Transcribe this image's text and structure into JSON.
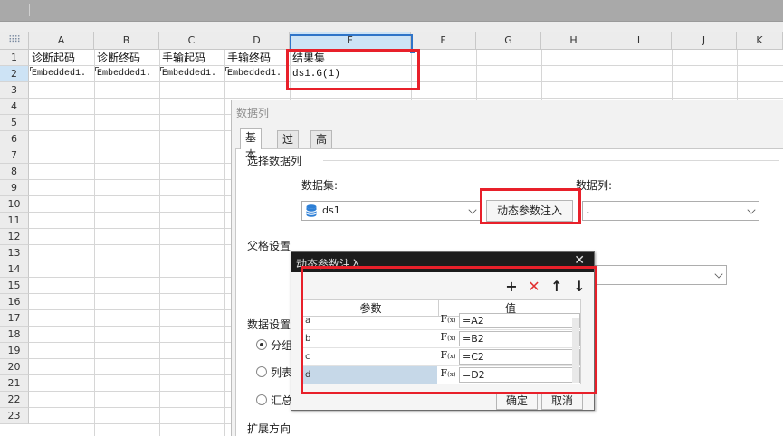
{
  "sheet": {
    "columns": [
      "A",
      "B",
      "C",
      "D",
      "E",
      "F",
      "G",
      "H",
      "I",
      "J",
      "K"
    ],
    "rows": [
      "1",
      "2",
      "3",
      "4",
      "5",
      "6",
      "7",
      "8",
      "9",
      "10",
      "11",
      "12",
      "13",
      "14",
      "15",
      "16",
      "17",
      "18",
      "19",
      "20",
      "21",
      "22",
      "23"
    ],
    "row1": [
      "诊断起码",
      "诊断终码",
      "手输起码",
      "手输终码",
      "结果集"
    ],
    "row2": [
      "Embedded1.",
      "Embedded1.",
      "Embedded1.",
      "Embedded1.",
      "ds1.G(1)"
    ]
  },
  "data_column_dialog": {
    "title": "数据列",
    "tabs": [
      "基本",
      "过滤",
      "高级"
    ],
    "select_column_section": "选择数据列",
    "dataset_label": "数据集:",
    "dataset_value": "ds1",
    "column_label": "数据列:",
    "column_value": ".",
    "dynamic_param_button": "动态参数注入",
    "parent_section": "父格设置",
    "parent_combo_value": "\\",
    "data_setting_section": "数据设置",
    "radio_options": [
      "分组",
      "列表",
      "汇总"
    ],
    "expand_section": "扩展方向"
  },
  "param_dialog": {
    "title": "动态参数注入",
    "close_glyph": "✕",
    "tools": [
      "+",
      "✕",
      "↑",
      "↓"
    ],
    "headers": [
      "参数",
      "值"
    ],
    "formula_glyph": "F",
    "formula_sub": "(x)",
    "rows": [
      {
        "name": "a",
        "value": "=A2"
      },
      {
        "name": "b",
        "value": "=B2"
      },
      {
        "name": "c",
        "value": "=C2"
      },
      {
        "name": "d",
        "value": "=D2"
      }
    ],
    "ok_label": "确定",
    "cancel_label": "取消"
  },
  "colors": {
    "highlight_red": "#e8202a",
    "selection_blue": "#2f74c8",
    "title_bar": "#1c1c1c"
  }
}
